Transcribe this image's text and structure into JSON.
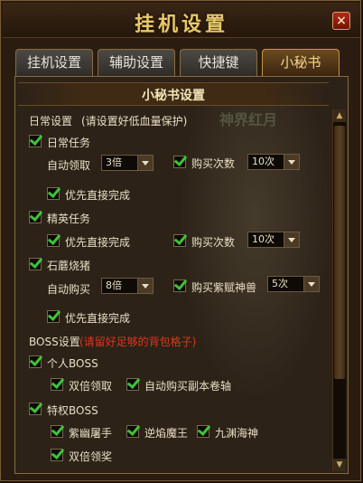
{
  "window": {
    "title": "挂机设置",
    "close_label": "×"
  },
  "tabs": [
    {
      "label": "挂机设置"
    },
    {
      "label": "辅助设置"
    },
    {
      "label": "快捷键"
    },
    {
      "label": "小秘书",
      "active": true
    }
  ],
  "section": {
    "title": "小秘书设置"
  },
  "background": {
    "text": "神界红月"
  },
  "daily": {
    "heading": "日常设置",
    "note": "(请设置好低血量保护)",
    "task_label": "日常任务",
    "auto_claim_label": "自动领取",
    "auto_claim_value": "3倍",
    "buy_times_label": "购买次数",
    "buy_times_value": "10次",
    "direct_finish_label": "优先直接完成"
  },
  "elite": {
    "task_label": "精英任务",
    "direct_finish_label": "优先直接完成",
    "buy_times_label": "购买次数",
    "buy_times_value": "10次"
  },
  "stone": {
    "label": "石蘑烧猪",
    "auto_buy_label": "自动购买",
    "auto_buy_value": "8倍",
    "buy_beast_label": "购买紫赋神兽",
    "buy_beast_value": "5次",
    "direct_finish_label": "优先直接完成"
  },
  "boss": {
    "heading": "BOSS设置",
    "note": "(请留好足够的背包格子)",
    "personal_label": "个人BOSS",
    "double_claim_label": "双倍领取",
    "auto_buy_scroll_label": "自动购买副本卷轴",
    "vip_label": "特权BOSS",
    "vip_items": [
      "紫幽屠手",
      "逆焰魔王",
      "九渊海神"
    ],
    "double_reward_label": "双倍领奖"
  },
  "colors": {
    "accent": "#e8c96a",
    "check": "#3ec23a",
    "warning": "#e0341e"
  }
}
